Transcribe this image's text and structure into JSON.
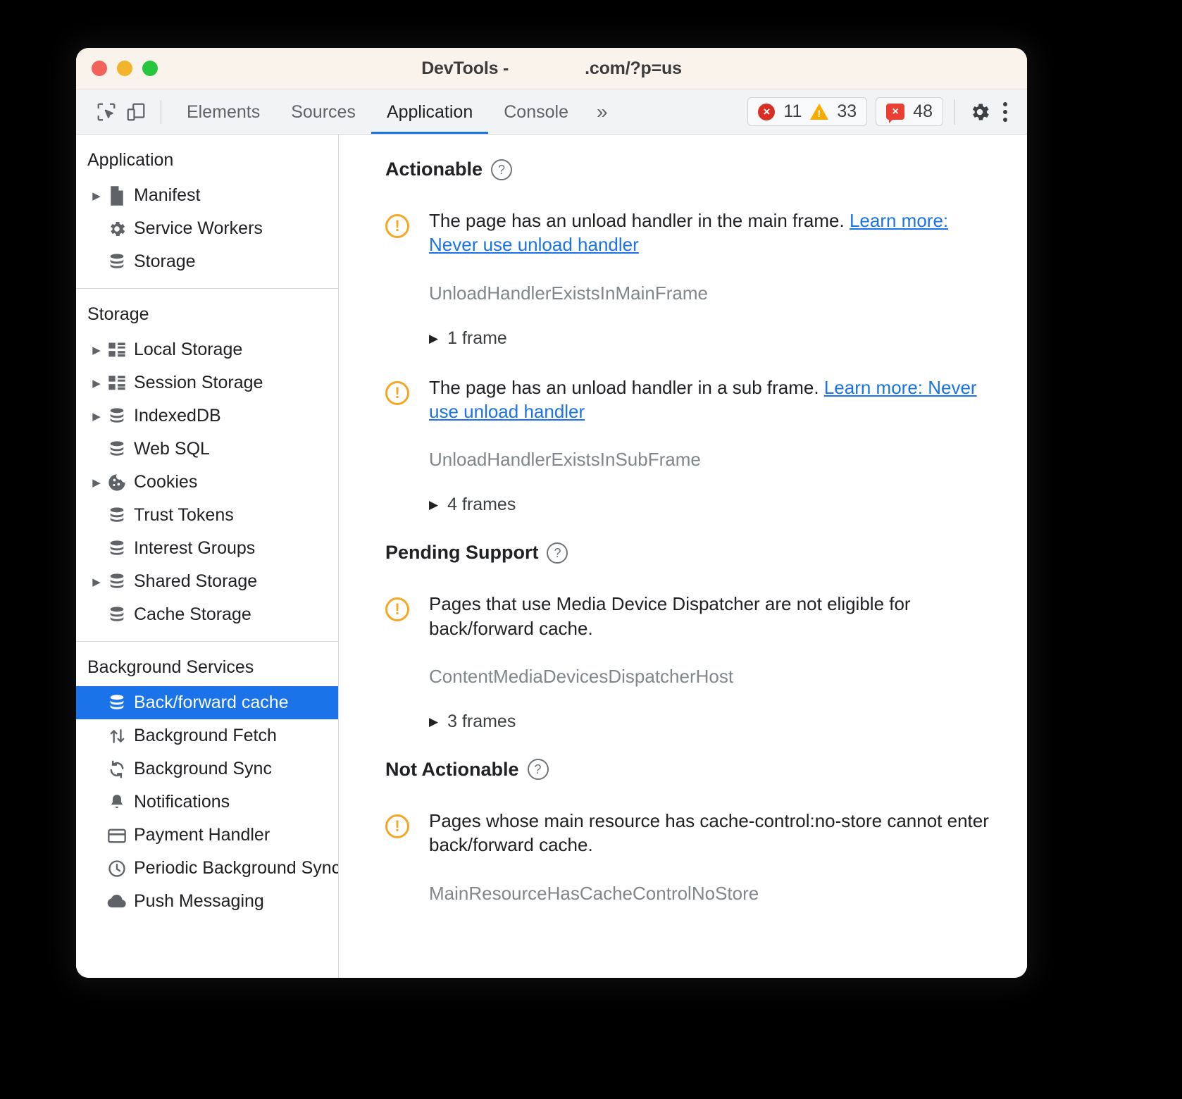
{
  "window": {
    "title_prefix": "DevTools -",
    "title_suffix": ".com/?p=us"
  },
  "toolbar": {
    "inspect_icon": "inspect-element-icon",
    "device_icon": "device-toolbar-icon",
    "tabs": [
      {
        "label": "Elements",
        "active": false
      },
      {
        "label": "Sources",
        "active": false
      },
      {
        "label": "Application",
        "active": true
      },
      {
        "label": "Console",
        "active": false
      }
    ],
    "more_tabs_label": "»",
    "errors_count": "11",
    "warnings_count": "33",
    "issues_count": "48",
    "error_glyph": "×",
    "issue_glyph": "×",
    "settings_icon": "gear-icon",
    "menu_icon": "kebab-menu-icon",
    "accent_color": "#1a73e8",
    "error_color": "#d93025",
    "warning_color": "#f9ab00",
    "issue_color": "#ea3f32"
  },
  "sidebar": {
    "groups": [
      {
        "title": "Application",
        "items": [
          {
            "label": "Manifest",
            "icon": "document-icon",
            "expandable": true,
            "selected": false
          },
          {
            "label": "Service Workers",
            "icon": "gear-icon",
            "expandable": false,
            "selected": false
          },
          {
            "label": "Storage",
            "icon": "database-icon",
            "expandable": false,
            "selected": false
          }
        ]
      },
      {
        "title": "Storage",
        "items": [
          {
            "label": "Local Storage",
            "icon": "table-icon",
            "expandable": true,
            "selected": false
          },
          {
            "label": "Session Storage",
            "icon": "table-icon",
            "expandable": true,
            "selected": false
          },
          {
            "label": "IndexedDB",
            "icon": "database-icon",
            "expandable": true,
            "selected": false
          },
          {
            "label": "Web SQL",
            "icon": "database-icon",
            "expandable": false,
            "selected": false
          },
          {
            "label": "Cookies",
            "icon": "cookie-icon",
            "expandable": true,
            "selected": false
          },
          {
            "label": "Trust Tokens",
            "icon": "database-icon",
            "expandable": false,
            "selected": false
          },
          {
            "label": "Interest Groups",
            "icon": "database-icon",
            "expandable": false,
            "selected": false
          },
          {
            "label": "Shared Storage",
            "icon": "database-icon",
            "expandable": true,
            "selected": false
          },
          {
            "label": "Cache Storage",
            "icon": "database-icon",
            "expandable": false,
            "selected": false
          }
        ]
      },
      {
        "title": "Background Services",
        "items": [
          {
            "label": "Back/forward cache",
            "icon": "database-icon",
            "expandable": false,
            "selected": true
          },
          {
            "label": "Background Fetch",
            "icon": "updown-arrows-icon",
            "expandable": false,
            "selected": false
          },
          {
            "label": "Background Sync",
            "icon": "sync-icon",
            "expandable": false,
            "selected": false
          },
          {
            "label": "Notifications",
            "icon": "bell-icon",
            "expandable": false,
            "selected": false
          },
          {
            "label": "Payment Handler",
            "icon": "credit-card-icon",
            "expandable": false,
            "selected": false
          },
          {
            "label": "Periodic Background Sync",
            "icon": "clock-icon",
            "expandable": false,
            "selected": false
          },
          {
            "label": "Push Messaging",
            "icon": "cloud-icon",
            "expandable": false,
            "selected": false
          }
        ]
      }
    ]
  },
  "main": {
    "sections": [
      {
        "heading": "Actionable",
        "help_glyph": "?",
        "issues": [
          {
            "text_before": "The page has an unload handler in the main frame. ",
            "link_text": "Learn more: Never use unload handler",
            "reason_code": "UnloadHandlerExistsInMainFrame",
            "frames_label": "1 frame",
            "warning_glyph": "!"
          },
          {
            "text_before": "The page has an unload handler in a sub frame. ",
            "link_text": "Learn more: Never use unload handler",
            "reason_code": "UnloadHandlerExistsInSubFrame",
            "frames_label": "4 frames",
            "warning_glyph": "!"
          }
        ]
      },
      {
        "heading": "Pending Support",
        "help_glyph": "?",
        "issues": [
          {
            "text_before": "Pages that use Media Device Dispatcher are not eligible for back/forward cache.",
            "link_text": "",
            "reason_code": "ContentMediaDevicesDispatcherHost",
            "frames_label": "3 frames",
            "warning_glyph": "!"
          }
        ]
      },
      {
        "heading": "Not Actionable",
        "help_glyph": "?",
        "issues": [
          {
            "text_before": "Pages whose main resource has cache-control:no-store cannot enter back/forward cache.",
            "link_text": "",
            "reason_code": "MainResourceHasCacheControlNoStore",
            "frames_label": "",
            "warning_glyph": "!"
          }
        ]
      }
    ]
  }
}
